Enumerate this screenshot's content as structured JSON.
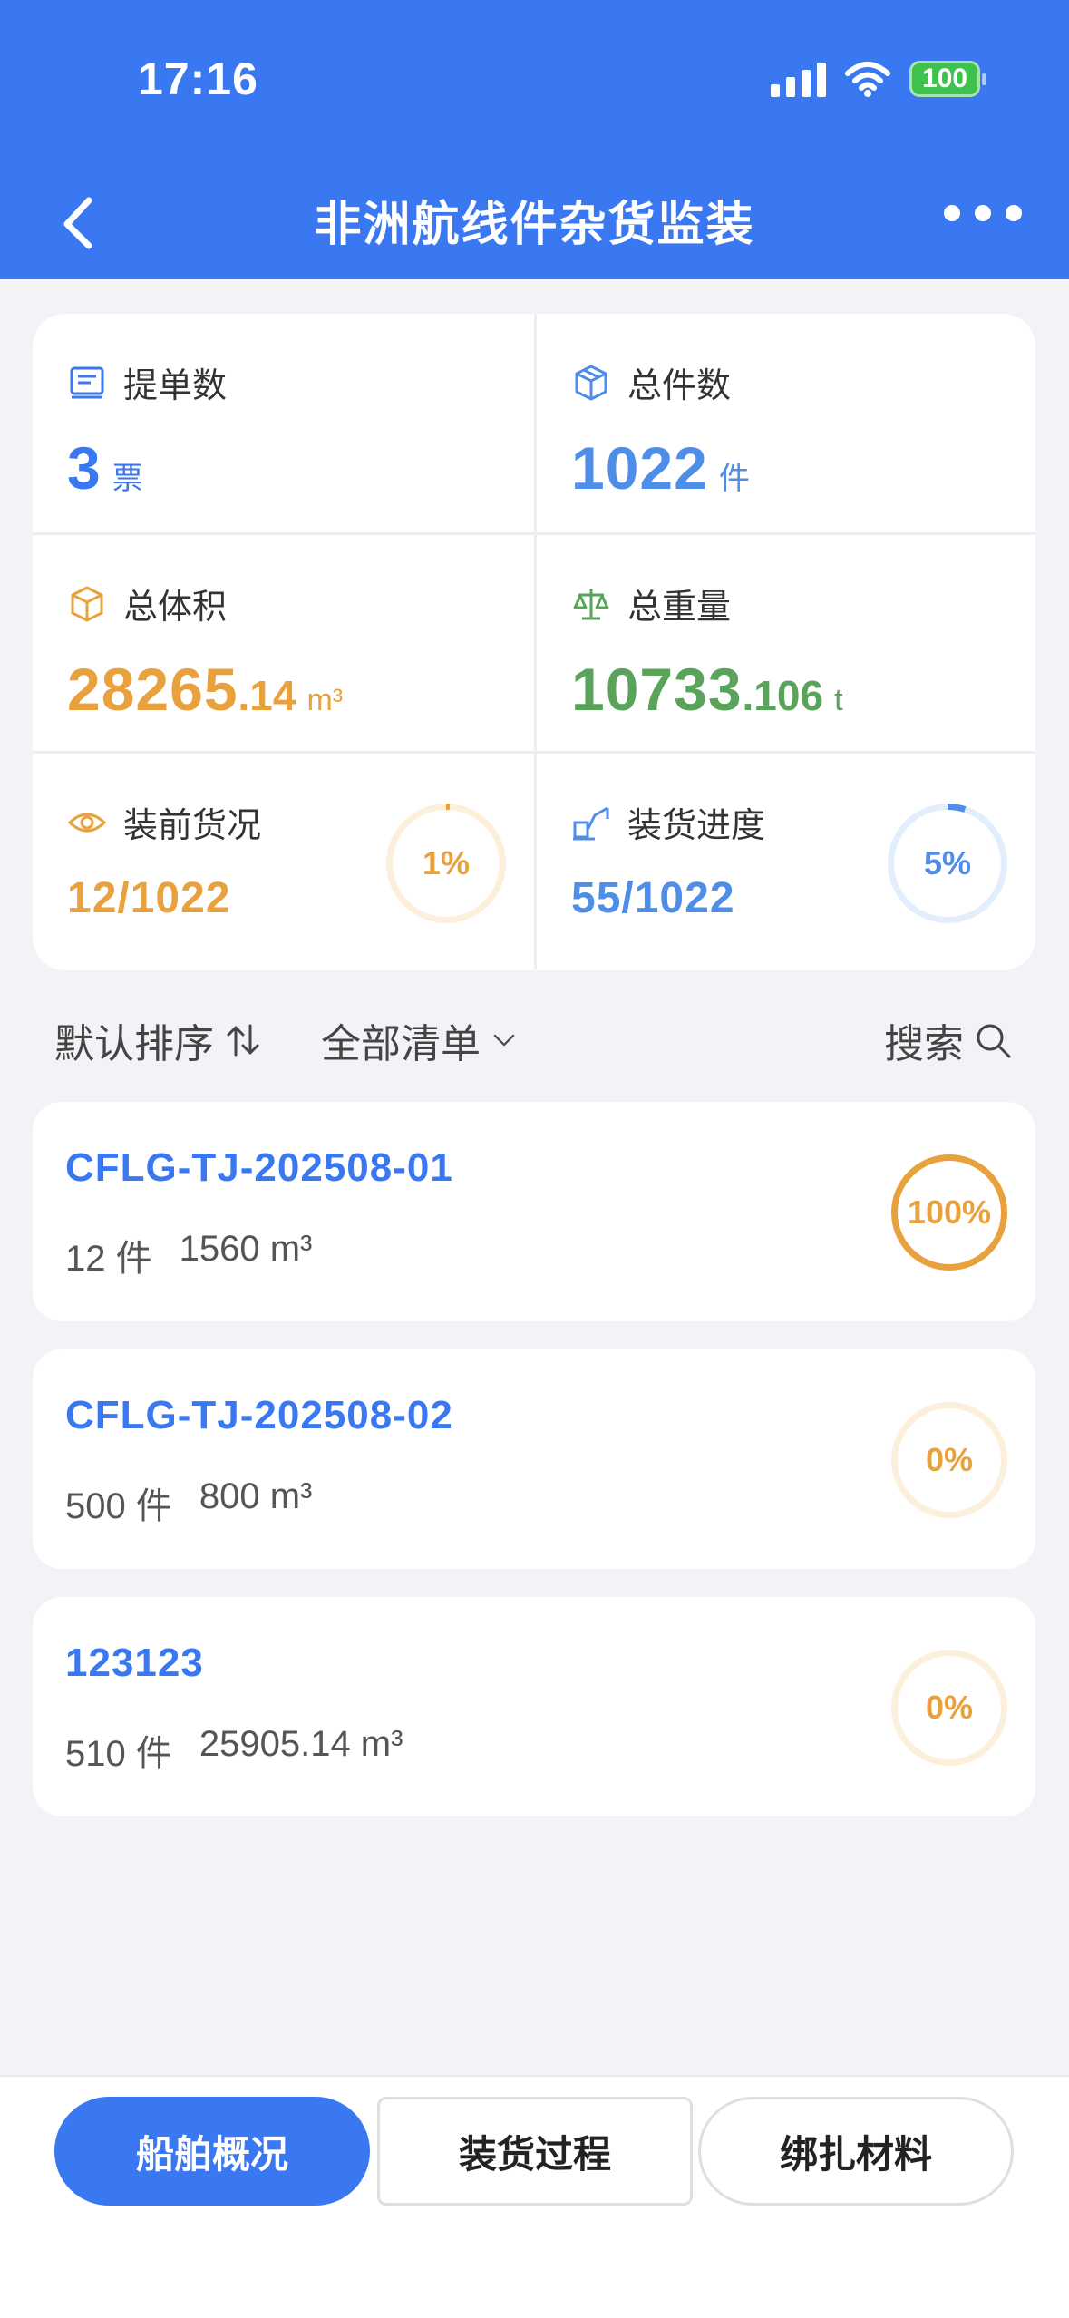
{
  "status": {
    "time": "17:16",
    "battery": "100"
  },
  "nav": {
    "title": "非洲航线件杂货监装"
  },
  "stats": {
    "bills": {
      "label": "提单数",
      "value": "3",
      "unit": "票"
    },
    "pieces": {
      "label": "总件数",
      "value": "1022",
      "unit": "件"
    },
    "volume": {
      "label": "总体积",
      "value_int": "28265",
      "value_dec": ".14",
      "unit": "m³"
    },
    "weight": {
      "label": "总重量",
      "value_int": "10733",
      "value_dec": ".106",
      "unit": "t"
    },
    "pre_cargo": {
      "label": "装前货况",
      "value": "12/1022",
      "percent_text": "1%",
      "percent": 1
    },
    "loading": {
      "label": "装货进度",
      "value": "55/1022",
      "percent_text": "5%",
      "percent": 5
    }
  },
  "filters": {
    "sort": "默认排序",
    "list": "全部清单",
    "search": "搜索"
  },
  "orders": [
    {
      "id": "CFLG-TJ-202508-01",
      "pieces": "12 件",
      "volume": "1560 m³",
      "percent_text": "100%",
      "percent": 100
    },
    {
      "id": "CFLG-TJ-202508-02",
      "pieces": "500 件",
      "volume": "800 m³",
      "percent_text": "0%",
      "percent": 0
    },
    {
      "id": "123123",
      "pieces": "510 件",
      "volume": "25905.14 m³",
      "percent_text": "0%",
      "percent": 0
    }
  ],
  "tabs": {
    "overview": "船舶概况",
    "process": "装货过程",
    "materials": "绑扎材料"
  },
  "colors": {
    "primary": "#3a78f2",
    "orange": "#e8a13c",
    "green": "#5aa35a"
  }
}
